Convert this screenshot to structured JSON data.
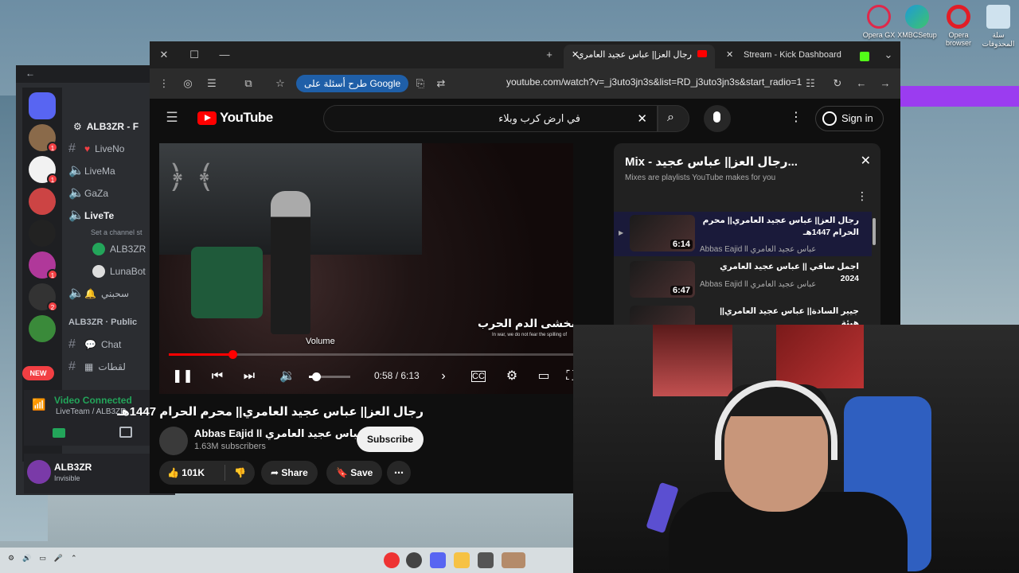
{
  "desktop_icons": [
    {
      "label": "Opera GX",
      "icon": "opera-gx-icon",
      "color": "#e0284a"
    },
    {
      "label": "XMBCSetup",
      "icon": "edge-icon",
      "color": "#1e9ad6"
    },
    {
      "label": "Opera browser",
      "icon": "opera-icon",
      "color": "#e21d26"
    },
    {
      "label": "سلة المحذوفات",
      "icon": "recycle-bin-icon",
      "color": "#cfe2ee"
    }
  ],
  "discord": {
    "server_name": "ALB3ZR - F",
    "new_badge": "NEW",
    "server_badges": [
      "1",
      "1",
      "1",
      "2"
    ],
    "channels": [
      {
        "type": "text",
        "label": "LiveNo",
        "icon": "heart-icon"
      },
      {
        "type": "voice",
        "label": "LiveMa",
        "icon": "speaker-icon"
      },
      {
        "type": "voice",
        "label": "GaZa",
        "icon": "flag-icon"
      },
      {
        "type": "voice",
        "label": "LiveTe",
        "icon": "speaker-icon"
      }
    ],
    "channel_status": "Set a channel st",
    "voice_users": [
      "ALB3ZR",
      "LunaBot"
    ],
    "more_channel": "سحبني",
    "category": "ALB3ZR · Public",
    "text_channels": [
      "Chat",
      "لقطات"
    ],
    "voice_status": "Video Connected",
    "voice_location": "LiveTeam / ALB3ZR",
    "user_name": "ALB3ZR",
    "user_status": "Invisible"
  },
  "browser": {
    "tabs": [
      {
        "title": "رجال العز|| عباس عجيد العامري",
        "active": true
      },
      {
        "title": "Stream - Kick Dashboard",
        "active": false
      }
    ],
    "ask_button": "طرح أسئلة على Google",
    "url": "youtube.com/watch?v=_j3uto3jn3s&list=RD_j3uto3jn3s&start_radio=1"
  },
  "youtube": {
    "logo": "YouTube",
    "search_query": "في ارض كرب وبلاء",
    "sign_in": "Sign in",
    "video": {
      "overlay_title": "لانخشى الدم الحرب",
      "overlay_caption": "In war, we do not fear the spilling of",
      "tooltip": "Volume",
      "time": "0:58 / 6:13",
      "progress_fraction": 0.157,
      "volume_fraction": 0.18
    },
    "title": "رجال العز|| عباس عجيد العامري|| محرم الحرام 1447هـ",
    "channel_name": "Abbas Eajid ll عباس عجيد العامري",
    "subscribers": "1.63M subscribers",
    "subscribe_label": "Subscribe",
    "actions": {
      "likes": "101K",
      "share": "Share",
      "save": "Save"
    },
    "playlist": {
      "title": "Mix - رجال العز|| عباس عجيد...",
      "subtitle": "Mixes are playlists YouTube makes for you",
      "items": [
        {
          "title": "رجال العز|| عباس عجيد العامري|| محرم الحرام 1447هـ",
          "channel": "Abbas Eajid ll عباس عجيد العامري",
          "duration": "6:14",
          "current": true
        },
        {
          "title": "اجمل ساقي || عباس عجيد العامري 2024",
          "channel": "Abbas Eajid ll عباس عجيد العامري",
          "duration": "6:47",
          "current": false
        },
        {
          "title": "جيير السادة|| عباس عجيد العامري|| هيئة",
          "channel": "",
          "duration": "",
          "current": false
        }
      ]
    }
  },
  "colors": {
    "youtube_red": "#ff0000",
    "discord_purple": "#9b3cf0",
    "ask_button_blue": "#1f5fa8",
    "voice_green": "#23a55a"
  }
}
